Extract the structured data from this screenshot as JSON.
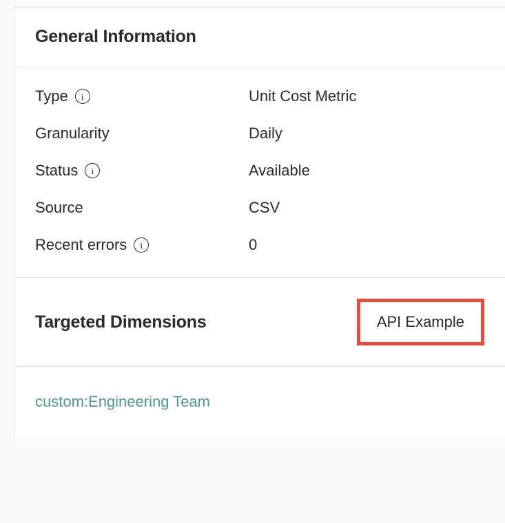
{
  "general_info": {
    "title": "General Information",
    "rows": {
      "type": {
        "label": "Type",
        "value": "Unit Cost Metric",
        "has_info": true
      },
      "granularity": {
        "label": "Granularity",
        "value": "Daily",
        "has_info": false
      },
      "status": {
        "label": "Status",
        "value": "Available",
        "has_info": true
      },
      "source": {
        "label": "Source",
        "value": "CSV",
        "has_info": false
      },
      "recent_errors": {
        "label": "Recent errors",
        "value": "0",
        "has_info": true
      }
    }
  },
  "targeted_dimensions": {
    "title": "Targeted Dimensions",
    "api_button_label": "API Example",
    "dimension_link": "custom:Engineering Team"
  }
}
